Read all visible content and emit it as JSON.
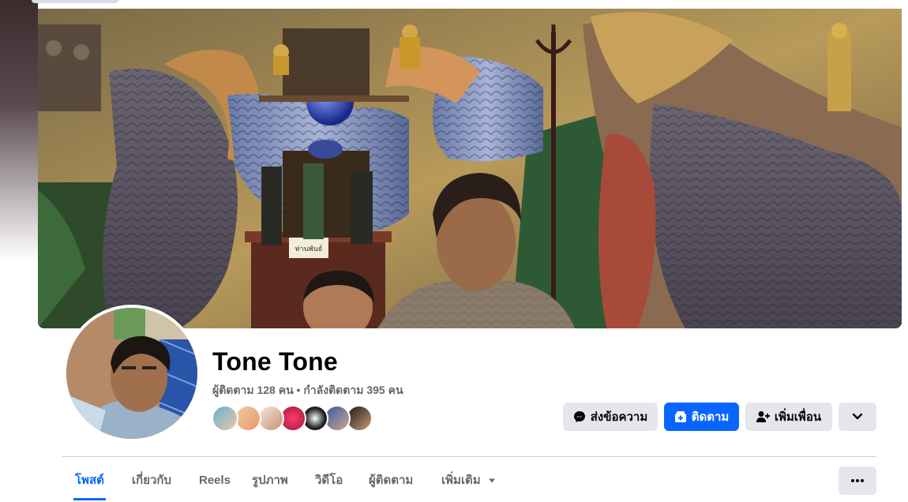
{
  "profile": {
    "name": "Tone Tone",
    "stats": "ผู้ติดตาม 128 คน • กำลังติดตาม 395 คน",
    "friend_avatar_count": 7
  },
  "actions": {
    "message_label": "ส่งข้อความ",
    "follow_label": "ติดตาม",
    "add_friend_label": "เพิ่มเพื่อน"
  },
  "tabs": [
    {
      "label": "โพสต์",
      "active": true
    },
    {
      "label": "เกี่ยวกับ",
      "active": false
    },
    {
      "label": "Reels",
      "active": false
    },
    {
      "label": "รูปภาพ",
      "active": false
    },
    {
      "label": "วิดีโอ",
      "active": false
    },
    {
      "label": "ผู้ติดตาม",
      "active": false
    },
    {
      "label": "เพิ่มเติม",
      "active": false
    }
  ],
  "cover_sign_text": "ท่านพันธ์",
  "colors": {
    "primary_blue": "#0866ff",
    "secondary_button": "#e4e6eb",
    "secondary_text": "#65676b",
    "divider": "#ced0d4"
  },
  "icons": {
    "message": "messenger-icon",
    "follow": "follow-icon",
    "add_friend": "add-friend-icon",
    "dropdown": "chevron-down-icon",
    "more": "more-dots-icon"
  }
}
